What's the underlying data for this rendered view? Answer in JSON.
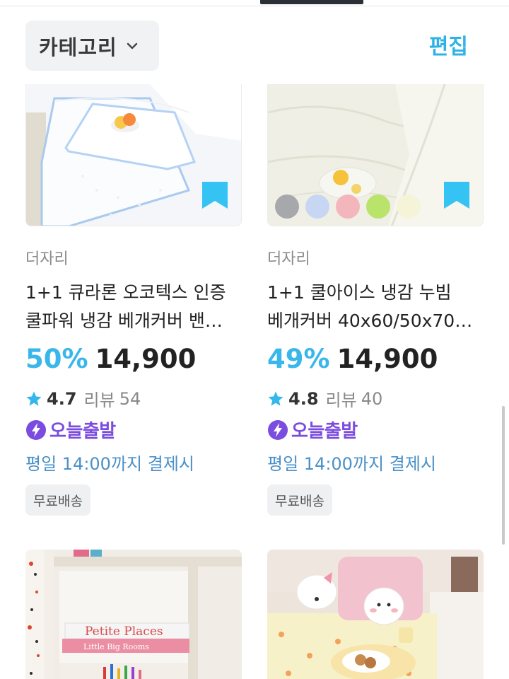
{
  "header": {
    "category_label": "카테고리",
    "edit_label": "편집"
  },
  "products": [
    {
      "brand": "더자리",
      "title_line1": "1+1 큐라론 오코텍스 인증",
      "title_line2": "쿨파워 냉감 베개커버 밴…",
      "discount": "50%",
      "price": "14,900",
      "rating": "4.7",
      "review_label": "리뷰",
      "review_count": "54",
      "today_label": "오늘출발",
      "deadline": "평일 14:00까지 결제시",
      "shipping": "무료배송"
    },
    {
      "brand": "더자리",
      "title_line1": "1+1 쿨아이스 냉감 누빔",
      "title_line2": "베개커버 40x60/50x70…",
      "discount": "49%",
      "price": "14,900",
      "rating": "4.8",
      "review_label": "리뷰",
      "review_count": "40",
      "today_label": "오늘출발",
      "deadline": "평일 14:00까지 결제시",
      "shipping": "무료배송",
      "color_swatches": [
        "#a7a8ab",
        "#c7d7f3",
        "#f3b6bd",
        "#b9e36a",
        "#f5f3d8"
      ]
    }
  ],
  "colors": {
    "accent_blue": "#3ab7ea",
    "bookmark_blue": "#34c3f2",
    "today_purple": "#7b4ce0",
    "deadline_blue": "#4a90c8"
  },
  "book_spine_lines": [
    "Petite Places",
    "Little Big Rooms"
  ],
  "icons": {
    "chevron": "chevron-down-icon",
    "bookmark": "bookmark-icon",
    "star": "star-icon",
    "bolt": "lightning-bolt-icon"
  }
}
